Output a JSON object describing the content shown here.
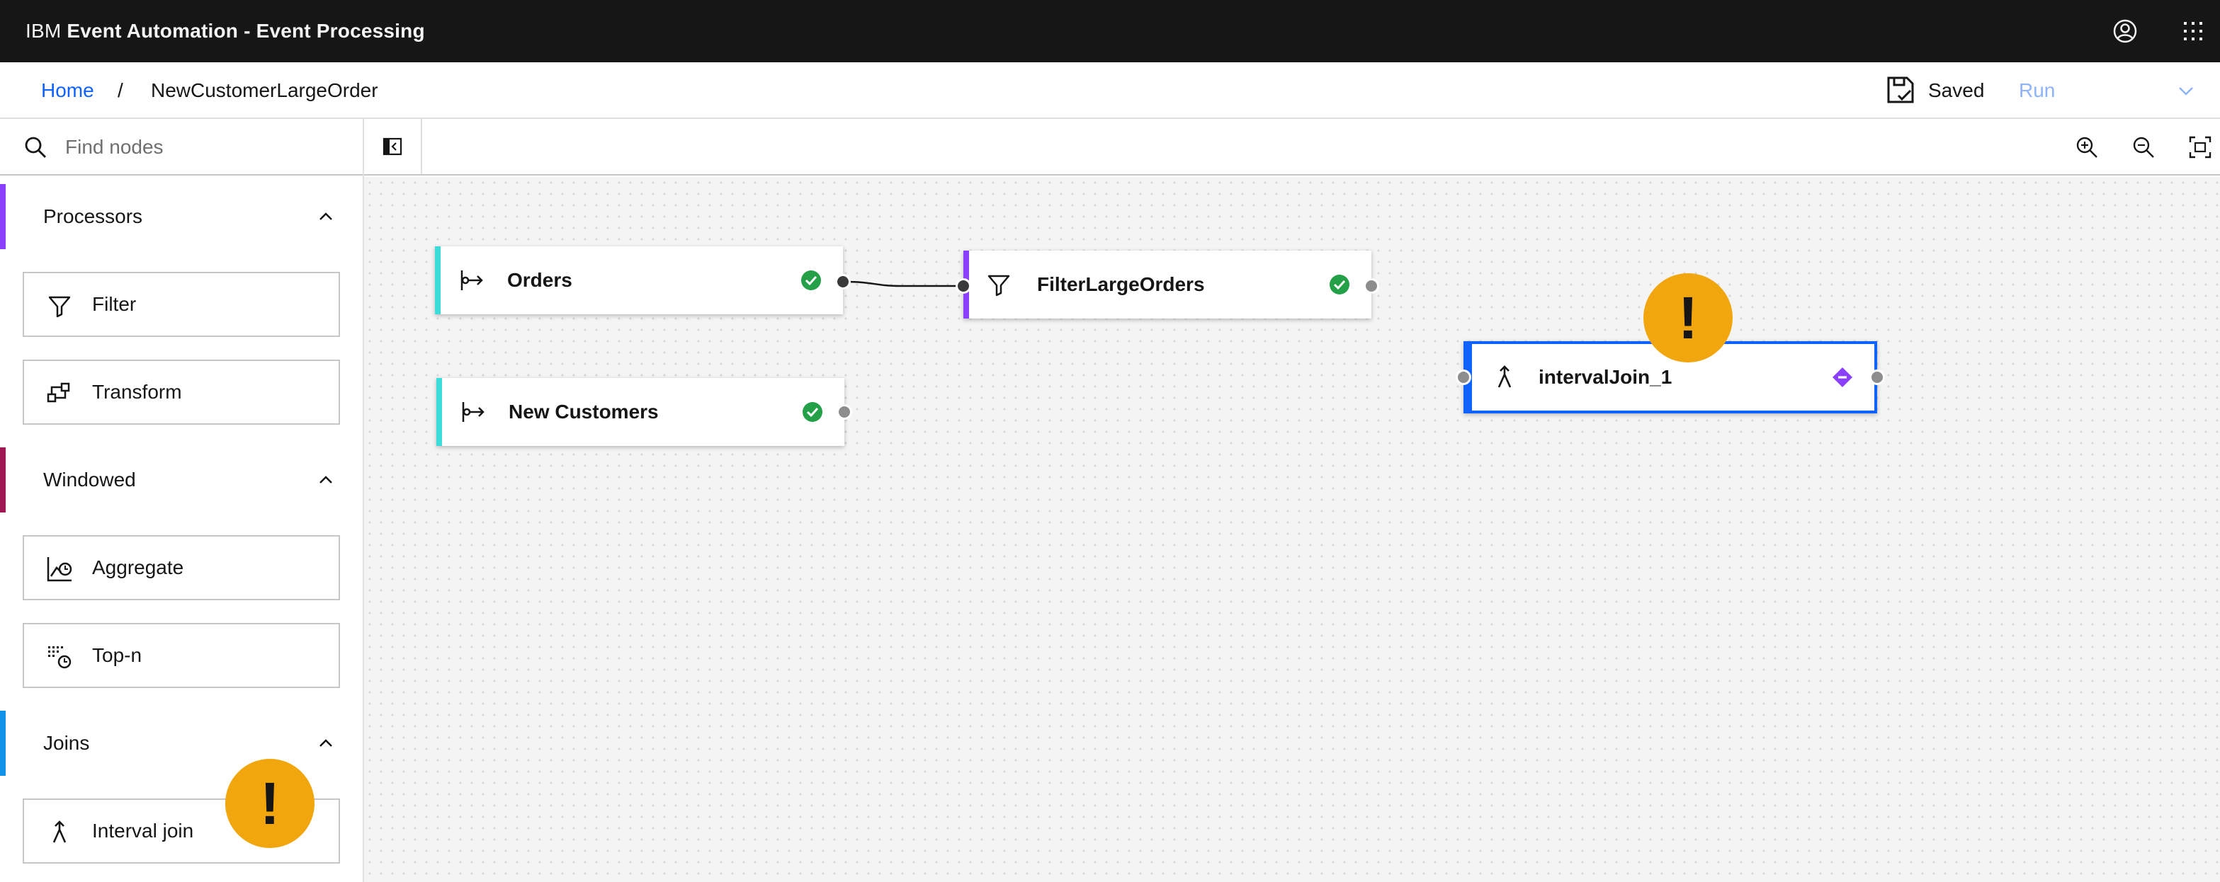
{
  "header": {
    "brand_prefix": "IBM",
    "brand_name": "Event Automation - Event Processing",
    "icons": [
      "user-avatar-icon",
      "app-switcher-icon"
    ]
  },
  "breadcrumb": {
    "home": "Home",
    "separator": "/",
    "current": "NewCustomerLargeOrder"
  },
  "status": {
    "saved_label": "Saved",
    "run_label": "Run"
  },
  "sidebar": {
    "search_placeholder": "Find nodes",
    "sections": [
      {
        "title": "Processors",
        "accent": "#8a3ffc",
        "items": [
          {
            "label": "Filter",
            "icon": "filter-icon"
          },
          {
            "label": "Transform",
            "icon": "transform-icon"
          }
        ]
      },
      {
        "title": "Windowed",
        "accent": "#9f1853",
        "items": [
          {
            "label": "Aggregate",
            "icon": "aggregate-icon"
          },
          {
            "label": "Top-n",
            "icon": "top-n-icon"
          }
        ]
      },
      {
        "title": "Joins",
        "accent": "#1192e8",
        "items": [
          {
            "label": "Interval join",
            "icon": "interval-join-icon"
          }
        ]
      }
    ]
  },
  "canvas": {
    "nodes": [
      {
        "label": "Orders",
        "kind": "event-source",
        "accent": "#3ddbd9",
        "status": "valid"
      },
      {
        "label": "New Customers",
        "kind": "event-source",
        "accent": "#3ddbd9",
        "status": "valid"
      },
      {
        "label": "FilterLargeOrders",
        "kind": "filter",
        "accent": "#8a3ffc",
        "status": "valid"
      },
      {
        "label": "intervalJoin_1",
        "kind": "interval-join",
        "accent": "#0f62fe",
        "status": "incomplete",
        "selected": true
      }
    ],
    "warning_symbol": "!",
    "connections": [
      {
        "from": "Orders",
        "to": "FilterLargeOrders"
      }
    ]
  },
  "colors": {
    "header_bg": "#161616",
    "link": "#0f62fe",
    "success": "#24a148",
    "warning": "#f1a60d",
    "selection": "#0f62fe"
  }
}
